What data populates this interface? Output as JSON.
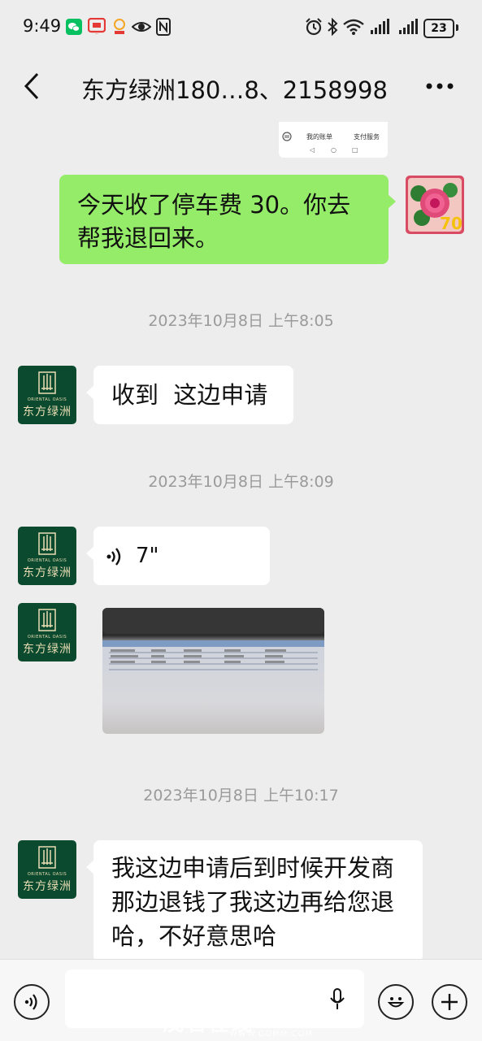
{
  "status_bar": {
    "time": "9:49",
    "battery": "23"
  },
  "header": {
    "title": "东方绿洲180…8、2158998"
  },
  "quoted_card": {
    "left_label": "我的账单",
    "right_label": "支付服务"
  },
  "messages": [
    {
      "side": "right",
      "text_line1": "今天收了停车费 30。你去",
      "text_line2": "帮我退回来。"
    },
    {
      "timestamp": "2023年10月8日 上午8:05"
    },
    {
      "side": "left",
      "text": "收到  这边申请"
    },
    {
      "timestamp": "2023年10月8日 上午8:09"
    },
    {
      "side": "left",
      "type": "voice",
      "duration": "7\""
    },
    {
      "side": "left",
      "type": "image"
    },
    {
      "timestamp": "2023年10月8日 上午10:17"
    },
    {
      "side": "left",
      "text_line1": "我这边申请后到时候开发商",
      "text_line2": "那边退钱了我这边再给您退",
      "text_line3": "哈，不好意思哈"
    }
  ],
  "avatar": {
    "corp_name": "东方绿洲",
    "corp_en": "ORIENTAL OASIS",
    "user_badge": "70"
  },
  "watermark": {
    "brand": "茂名在线",
    "url": "WWW.GDMM.COM"
  },
  "colors": {
    "background": "#ededed",
    "bubble_self": "#95ec69",
    "bubble_other": "#ffffff",
    "corp_avatar": "#0b4a2e"
  },
  "icons": [
    "back-icon",
    "more-icon",
    "voice-mode-icon",
    "microphone-icon",
    "emoji-icon",
    "plus-icon",
    "voice-wave-icon"
  ]
}
